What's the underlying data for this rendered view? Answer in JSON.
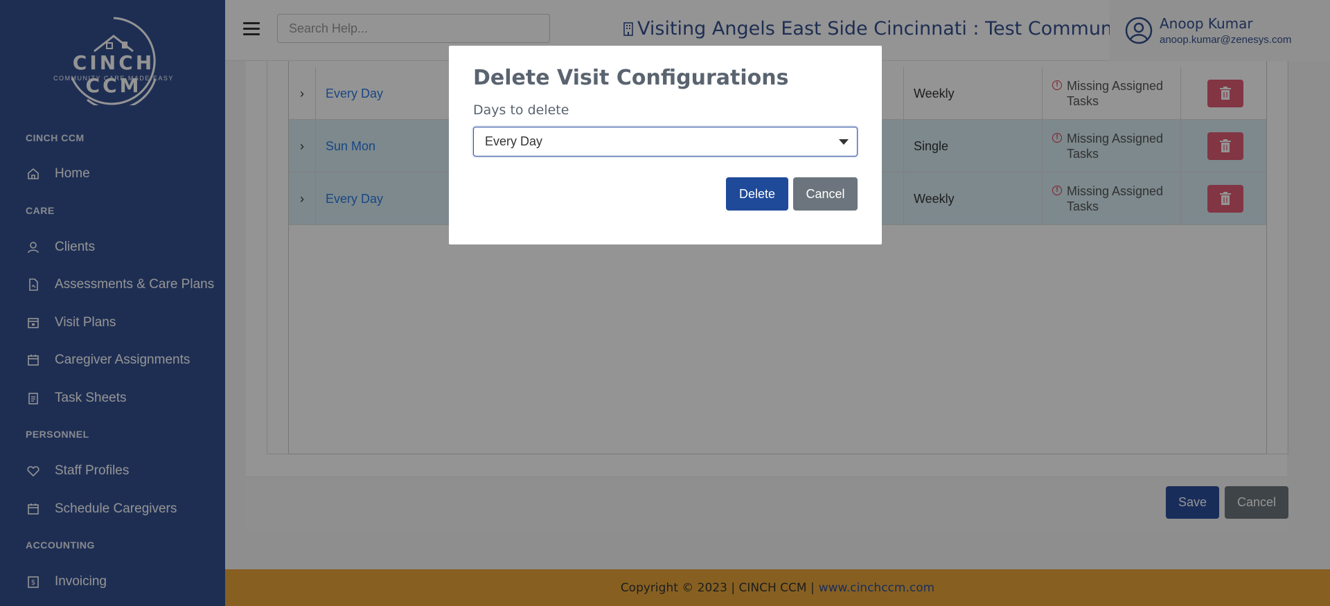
{
  "sidebar": {
    "logo": {
      "name": "CINCH CCM",
      "tagline": "COMMUNITY CARE MADE EASY"
    },
    "sections": [
      {
        "title": "CINCH CCM",
        "items": [
          {
            "label": "Home",
            "icon": "home-icon"
          }
        ]
      },
      {
        "title": "CARE",
        "items": [
          {
            "label": "Clients",
            "icon": "user-icon"
          },
          {
            "label": "Assessments & Care Plans",
            "icon": "document-icon"
          },
          {
            "label": "Visit Plans",
            "icon": "calendar-icon"
          },
          {
            "label": "Caregiver Assignments",
            "icon": "calendar-icon"
          },
          {
            "label": "Task Sheets",
            "icon": "clipboard-icon"
          }
        ]
      },
      {
        "title": "PERSONNEL",
        "items": [
          {
            "label": "Staff Profiles",
            "icon": "heart-icon"
          },
          {
            "label": "Schedule Caregivers",
            "icon": "calendar-icon"
          }
        ]
      },
      {
        "title": "ACCOUNTING",
        "items": [
          {
            "label": "Invoicing",
            "icon": "invoice-icon"
          }
        ]
      }
    ]
  },
  "header": {
    "search_placeholder": "Search Help...",
    "community": "Visiting Angels East Side Cincinnati : Test Community",
    "user_name": "Anoop Kumar",
    "user_email": "anoop.kumar@zenesys.com"
  },
  "table": {
    "rows": [
      {
        "days": "Every Day",
        "frequency": "Weekly",
        "status": "Missing Assigned Tasks"
      },
      {
        "days": "Sun Mon",
        "frequency": "Single",
        "status": "Missing Assigned Tasks"
      },
      {
        "days": "Every Day",
        "frequency": "Weekly",
        "status": "Missing Assigned Tasks"
      }
    ]
  },
  "actions": {
    "save": "Save",
    "cancel": "Cancel"
  },
  "footer": {
    "copyright": "Copyright © 2023 | CINCH CCM |",
    "link": "www.cinchccm.com"
  },
  "modal": {
    "title": "Delete Visit Configurations",
    "label": "Days to delete",
    "selected": "Every Day",
    "delete": "Delete",
    "cancel": "Cancel"
  },
  "colors": {
    "sidebar": "#34508f",
    "primary": "#2c4f9e",
    "danger": "#e05c74",
    "footer": "#e8a53a",
    "link": "#2a7ae2"
  }
}
